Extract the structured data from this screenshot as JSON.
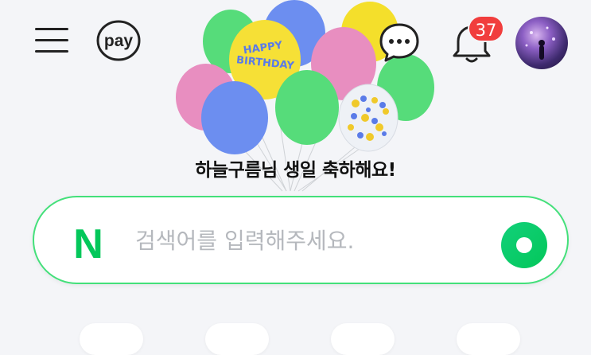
{
  "header": {
    "menu_icon": "hamburger-menu-icon",
    "pay_label": "pay",
    "chat_icon": "chat-bubble-icon",
    "bell_icon": "bell-icon",
    "notification_count": "37",
    "avatar_icon": "profile-avatar"
  },
  "banner": {
    "balloon_text_line1": "HAPPY",
    "balloon_text_line2": "BIRTHDAY",
    "greeting": "하늘구름님 생일 축하해요!"
  },
  "search": {
    "logo_letter": "N",
    "placeholder": "검색어를 입력해주세요.",
    "button_icon": "search-circle-icon"
  },
  "colors": {
    "brand_green": "#03c75a",
    "border_green": "#43e07a",
    "badge_red": "#f13d3d"
  }
}
